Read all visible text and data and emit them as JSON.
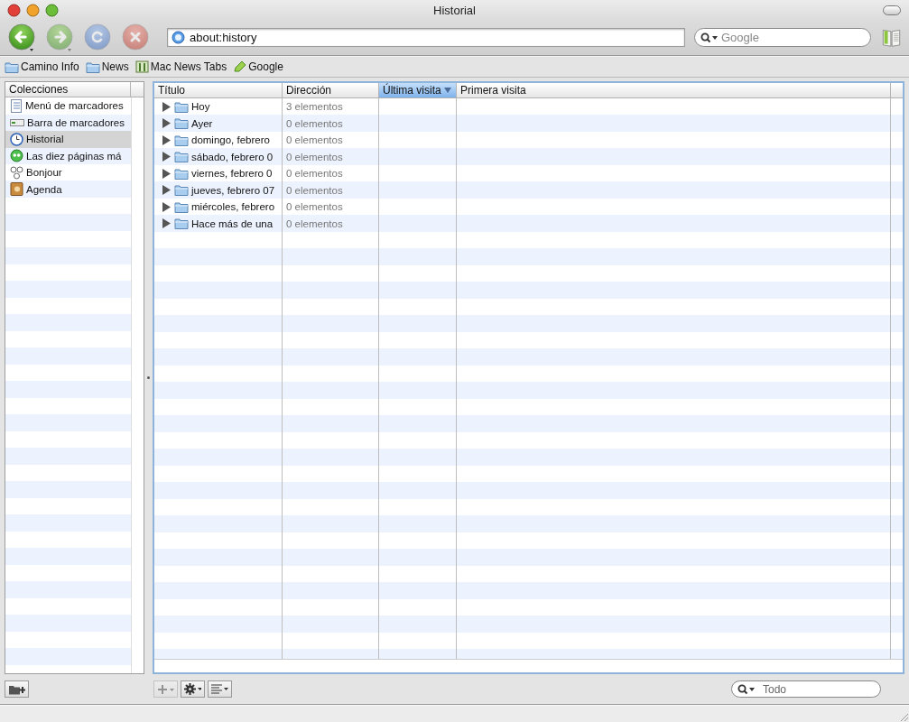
{
  "window": {
    "title": "Historial"
  },
  "toolbar": {
    "buttons": [
      {
        "kind": "back",
        "disabled": false
      },
      {
        "kind": "forward",
        "disabled": true
      },
      {
        "kind": "reload",
        "disabled": true
      },
      {
        "kind": "stop",
        "disabled": true
      }
    ],
    "address": {
      "value": "about:history"
    },
    "search": {
      "placeholder": "Google"
    }
  },
  "bookmarks_bar": [
    {
      "label": "Camino Info",
      "kind": "folder"
    },
    {
      "label": "News",
      "kind": "folder"
    },
    {
      "label": "Mac News Tabs",
      "kind": "tabs"
    },
    {
      "label": "Google",
      "kind": "bookmark"
    }
  ],
  "sidebar": {
    "header": "Colecciones",
    "items": [
      {
        "label": "Menú de marcadores",
        "kind": "menu",
        "selected": false
      },
      {
        "label": "Barra de marcadores",
        "kind": "bar",
        "selected": false
      },
      {
        "label": "Historial",
        "kind": "history",
        "selected": true
      },
      {
        "label": "Las diez páginas má",
        "kind": "top10",
        "selected": false
      },
      {
        "label": "Bonjour",
        "kind": "bonjour",
        "selected": false
      },
      {
        "label": "Agenda",
        "kind": "addressbook",
        "selected": false
      }
    ]
  },
  "table": {
    "columns": [
      {
        "label": "Título",
        "sorted": false
      },
      {
        "label": "Dirección",
        "sorted": false
      },
      {
        "label": "Última visita",
        "sorted": true
      },
      {
        "label": "Primera visita",
        "sorted": false
      }
    ],
    "rows": [
      {
        "title": "Hoy",
        "address": "3 elementos",
        "expanded": false
      },
      {
        "title": "Ayer",
        "address": "0 elementos",
        "expanded": false
      },
      {
        "title": "domingo, febrero",
        "address": "0 elementos",
        "expanded": false
      },
      {
        "title": "sábado, febrero 0",
        "address": "0 elementos",
        "expanded": false
      },
      {
        "title": "viernes, febrero 0",
        "address": "0 elementos",
        "expanded": false
      },
      {
        "title": "jueves, febrero 07",
        "address": "0 elementos",
        "expanded": false
      },
      {
        "title": "miércoles, febrero",
        "address": "0 elementos",
        "expanded": false
      },
      {
        "title": "Hace más de una",
        "address": "0 elementos",
        "expanded": false
      }
    ]
  },
  "bottom_bar": {
    "add_disabled": true,
    "filter": {
      "placeholder": "Todo"
    }
  }
}
